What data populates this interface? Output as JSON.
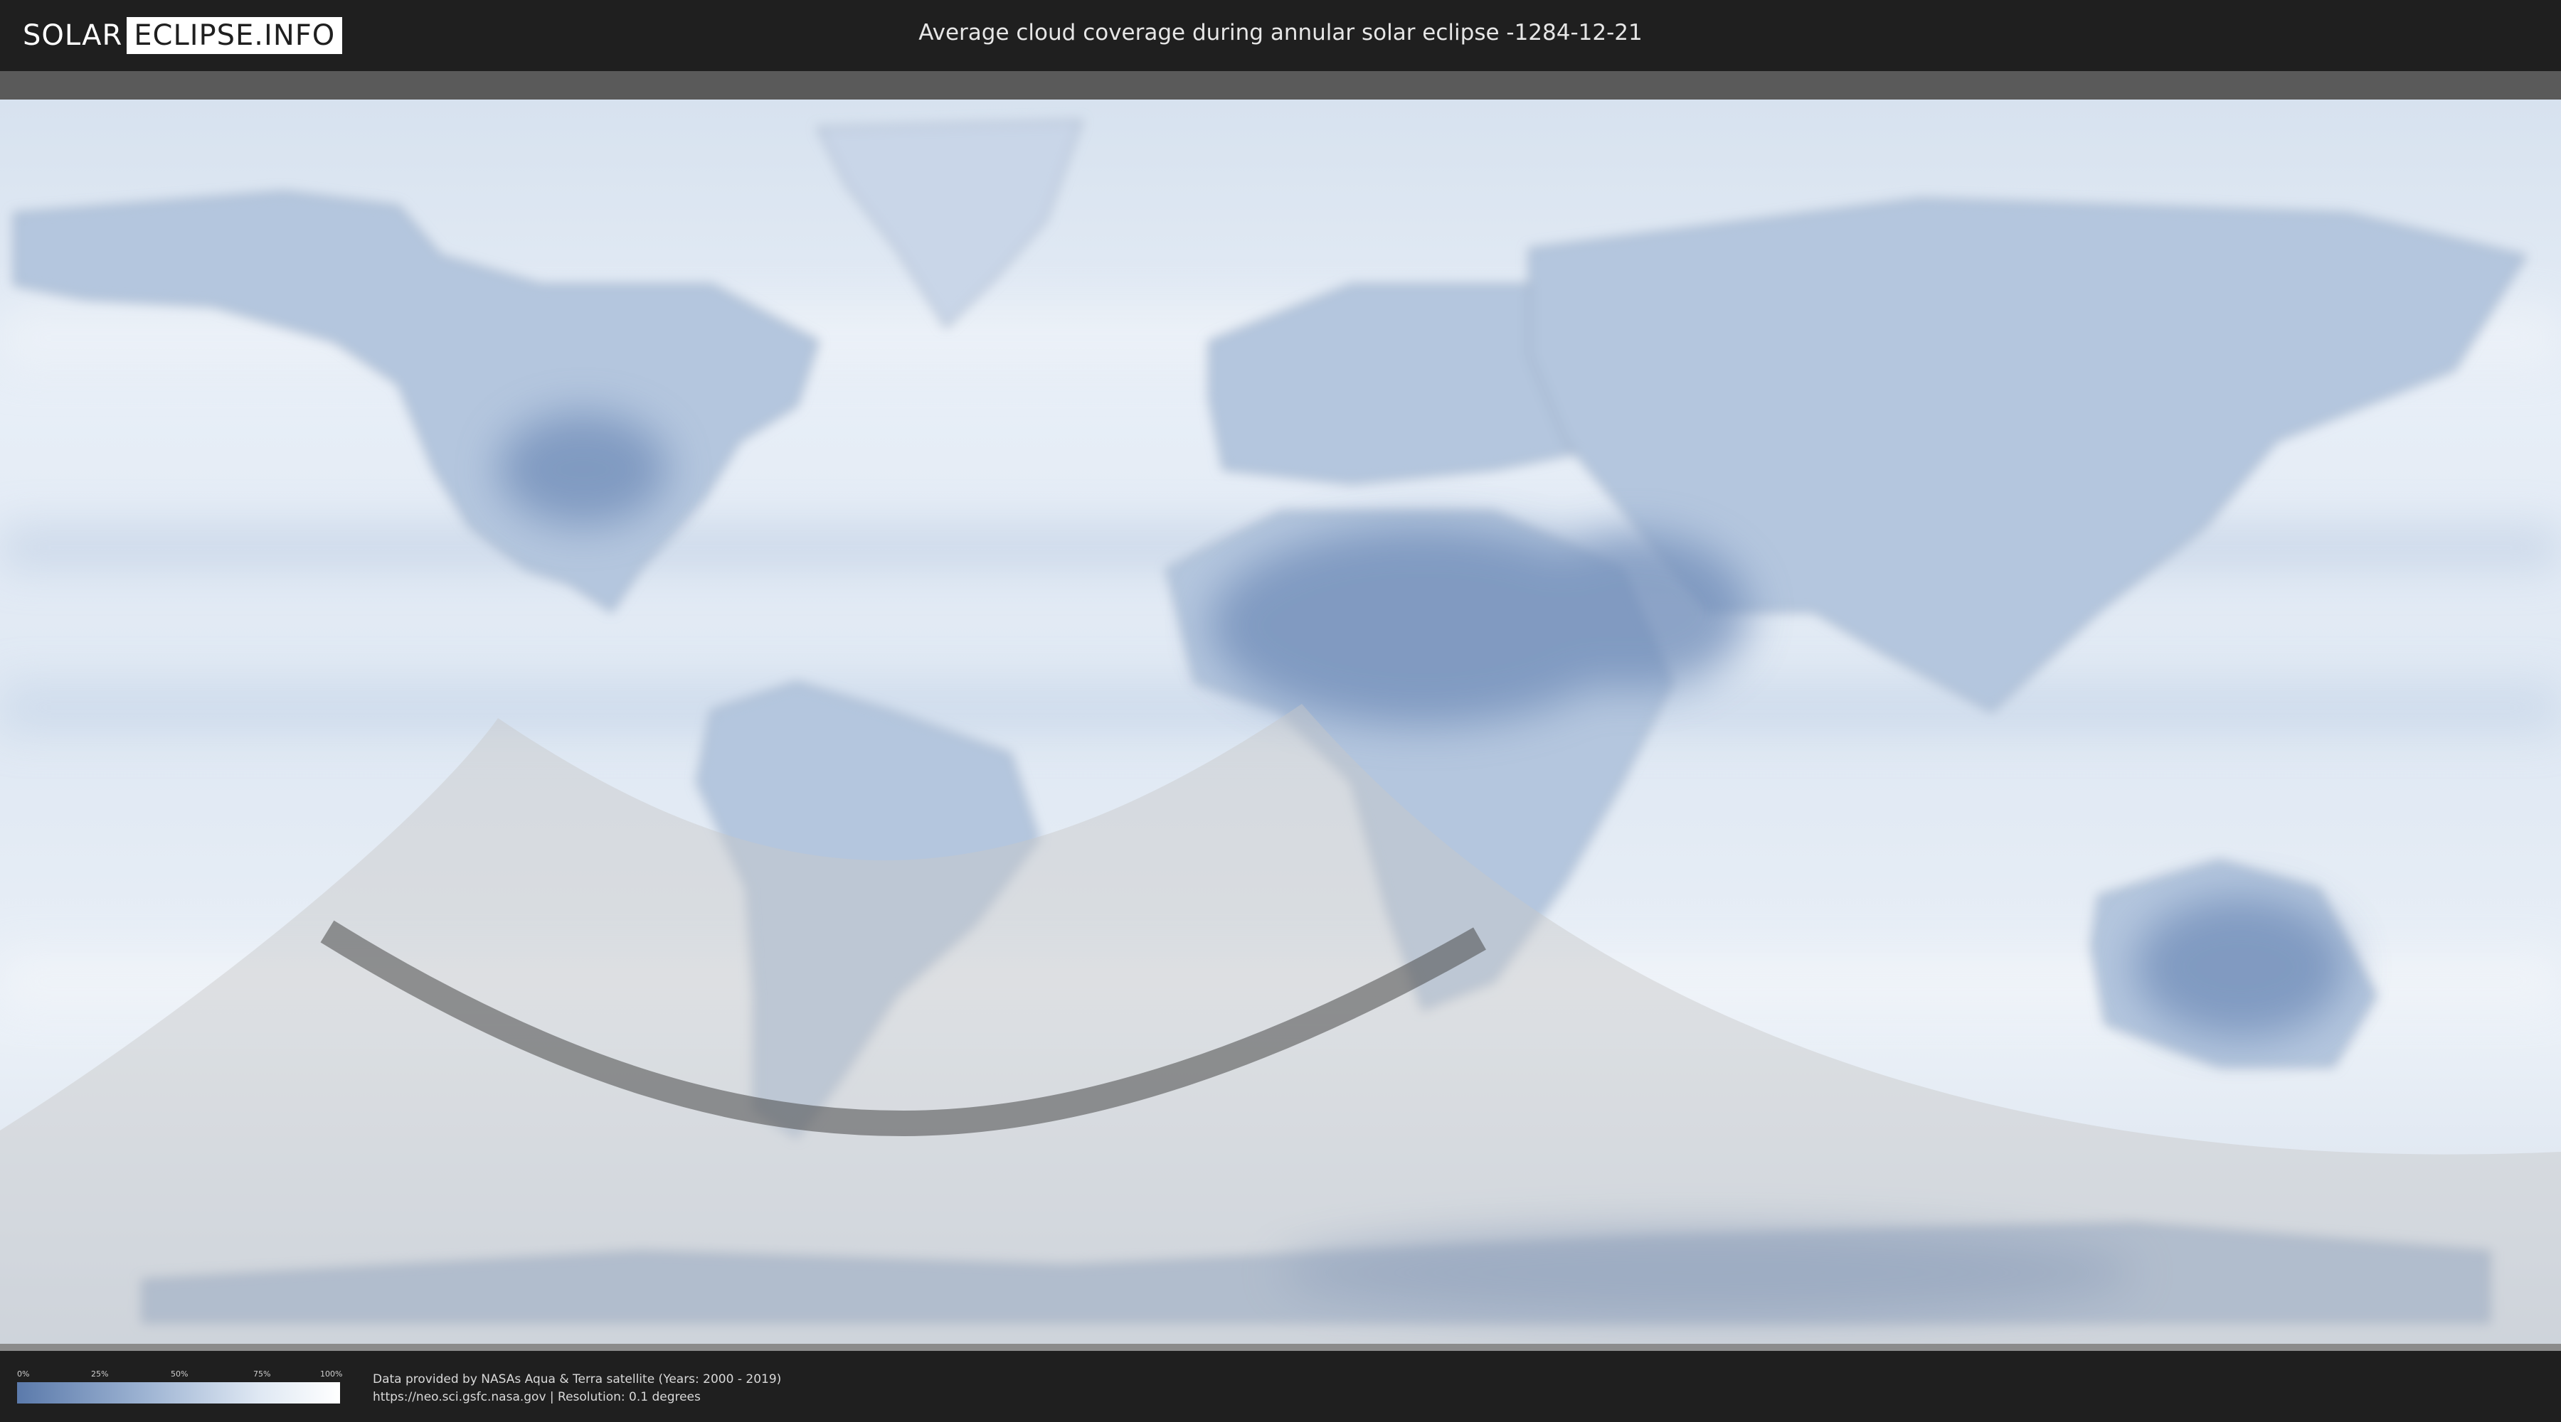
{
  "header": {
    "logo_solar": "SOLAR",
    "logo_eclipse": "ECLIPSE.INFO",
    "title": "Average cloud coverage during annular solar eclipse -1284-12-21"
  },
  "map": {
    "colors": {
      "ocean_cloud": "#e9eff7",
      "land_clear": "#6f8cb8",
      "shadow_overlay": "#c8c8c8",
      "path_band": "#4a4a4a",
      "header_bg": "#1f1f1f"
    }
  },
  "legend": {
    "ticks": [
      "0%",
      "25%",
      "50%",
      "75%",
      "100%"
    ],
    "gradient": [
      "#5b7aab",
      "#9eb4d3",
      "#dfe8f3",
      "#ffffff"
    ]
  },
  "credits": {
    "line1": "Data provided by NASAs Aqua & Terra satellite (Years: 2000 - 2019)",
    "line2": "https://neo.sci.gsfc.nasa.gov | Resolution: 0.1 degrees"
  }
}
